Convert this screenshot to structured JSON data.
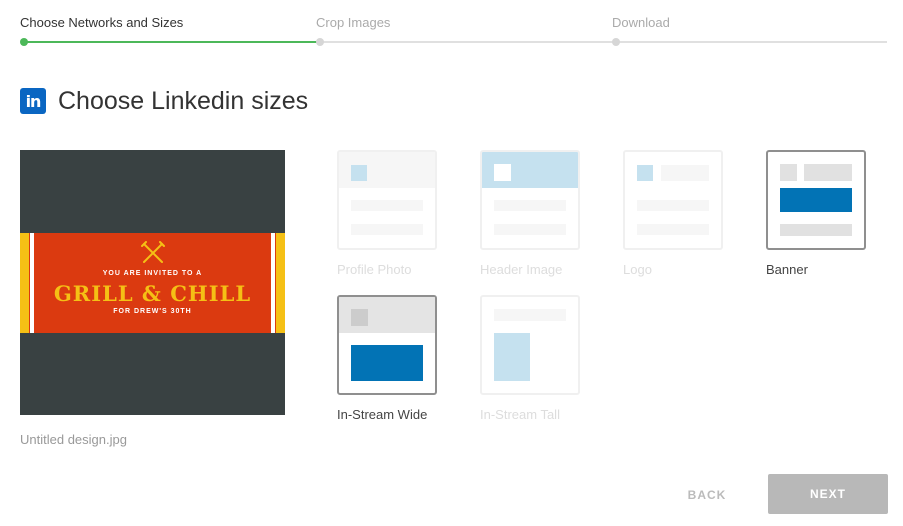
{
  "stepper": {
    "steps": [
      {
        "label": "Choose Networks and Sizes",
        "state": "active"
      },
      {
        "label": "Crop Images",
        "state": "pending"
      },
      {
        "label": "Download",
        "state": "pending"
      }
    ],
    "progress_color": "#4cb859"
  },
  "header": {
    "network_icon": "linkedin-icon",
    "network_icon_text": "in",
    "title": "Choose Linkedin sizes",
    "brand_color": "#0a66c2"
  },
  "preview": {
    "filename": "Untitled design.jpg",
    "design": {
      "icon": "crossed-forks-icon",
      "line1": "YOU ARE INVITED TO A",
      "headline": "GRILL & CHILL",
      "line3": "FOR DREW'S 30TH"
    }
  },
  "sizes": [
    {
      "label": "Profile Photo",
      "selected": false
    },
    {
      "label": "Header Image",
      "selected": false
    },
    {
      "label": "Logo",
      "selected": false
    },
    {
      "label": "Banner",
      "selected": true
    },
    {
      "label": "In-Stream Wide",
      "selected": true
    },
    {
      "label": "In-Stream Tall",
      "selected": false
    }
  ],
  "actions": {
    "back_label": "BACK",
    "next_label": "NEXT"
  }
}
